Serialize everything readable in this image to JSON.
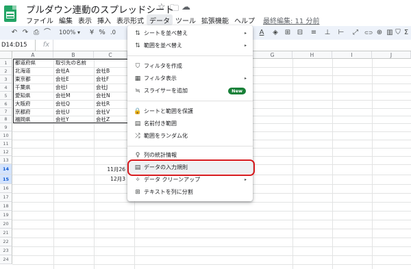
{
  "title_bar": {
    "doc_title": "プルダウン連動のスプレッドシート",
    "star_icon": "☆",
    "move_icon": "🗀",
    "cloud_icon": "☁"
  },
  "menubar": {
    "items": [
      "ファイル",
      "編集",
      "表示",
      "挿入",
      "表示形式",
      "データ",
      "ツール",
      "拡張機能",
      "ヘルプ"
    ],
    "last_edit": "最終編集: 11 分前"
  },
  "toolbar": {
    "undo": "↶",
    "redo": "↷",
    "print": "⎙",
    "paint_format": "⌒",
    "zoom": "100%",
    "zoom_caret": "▾",
    "currency": "¥",
    "percent": "%",
    "decimal_decrease": ".0",
    "text_color": "A",
    "fill_color": "◈",
    "borders": "⊞",
    "merge": "⊟",
    "align": "≡",
    "valign": "⊥",
    "wrap": "⊢",
    "rotate": "⤢",
    "link": "⊂⊃",
    "comment": "⊕",
    "chart": "▥",
    "filter": "⛉",
    "functions": "Σ"
  },
  "formula_bar": {
    "name_box": "D14:D15",
    "fx_label": "fx"
  },
  "columns": [
    "A",
    "B",
    "C",
    "",
    "",
    "",
    "G",
    "H",
    "I",
    "J"
  ],
  "rows": [
    "1",
    "2",
    "3",
    "4",
    "5",
    "6",
    "7",
    "8",
    "9",
    "10",
    "11",
    "12",
    "13",
    "14",
    "15",
    "16",
    "17",
    "18",
    "19",
    "20",
    "21",
    "22",
    "23",
    "24"
  ],
  "cells": {
    "A1": "都道府県",
    "B1": "取引先の名前",
    "A2": "北海道",
    "B2": "会社A",
    "C2": "会社B",
    "A3": "東京都",
    "B3": "会社E",
    "C3": "会社F",
    "A4": "千葉県",
    "B4": "会社I",
    "C4": "会社J",
    "A5": "愛知県",
    "B5": "会社M",
    "C5": "会社N",
    "A6": "大阪府",
    "B6": "会社Q",
    "C6": "会社R",
    "A7": "京都府",
    "B7": "会社U",
    "C7": "会社V",
    "A8": "福岡県",
    "B8": "会社Y",
    "C8": "会社Z",
    "C14": "11月26",
    "C15": "12月3"
  },
  "data_menu": {
    "items": [
      {
        "icon": "⇅",
        "label": "シートを並べ替え",
        "submenu": true
      },
      {
        "icon": "⇅",
        "label": "範囲を並べ替え",
        "submenu": true
      },
      {
        "icon": "⛉",
        "label": "フィルタを作成"
      },
      {
        "icon": "▦",
        "label": "フィルタ表示",
        "submenu": true
      },
      {
        "icon": "≒",
        "label": "スライサーを追加",
        "badge": "New"
      },
      {
        "icon": "🔒",
        "label": "シートと範囲を保護"
      },
      {
        "icon": "▤",
        "label": "名前付き範囲"
      },
      {
        "icon": "⤮",
        "label": "範囲をランダム化"
      },
      {
        "icon": "♀",
        "label": "列の統計情報"
      },
      {
        "icon": "▤",
        "label": "データの入力規則"
      },
      {
        "icon": "✧",
        "label": "データ クリーンアップ",
        "submenu": true
      },
      {
        "icon": "⊞",
        "label": "テキストを列に分割"
      }
    ],
    "submenu_arrow": "▸"
  },
  "colors": {
    "accent": "#0b57d0",
    "highlight_ring": "#d6191d",
    "new_badge": "#188038",
    "sheets_green": "#23a566"
  }
}
